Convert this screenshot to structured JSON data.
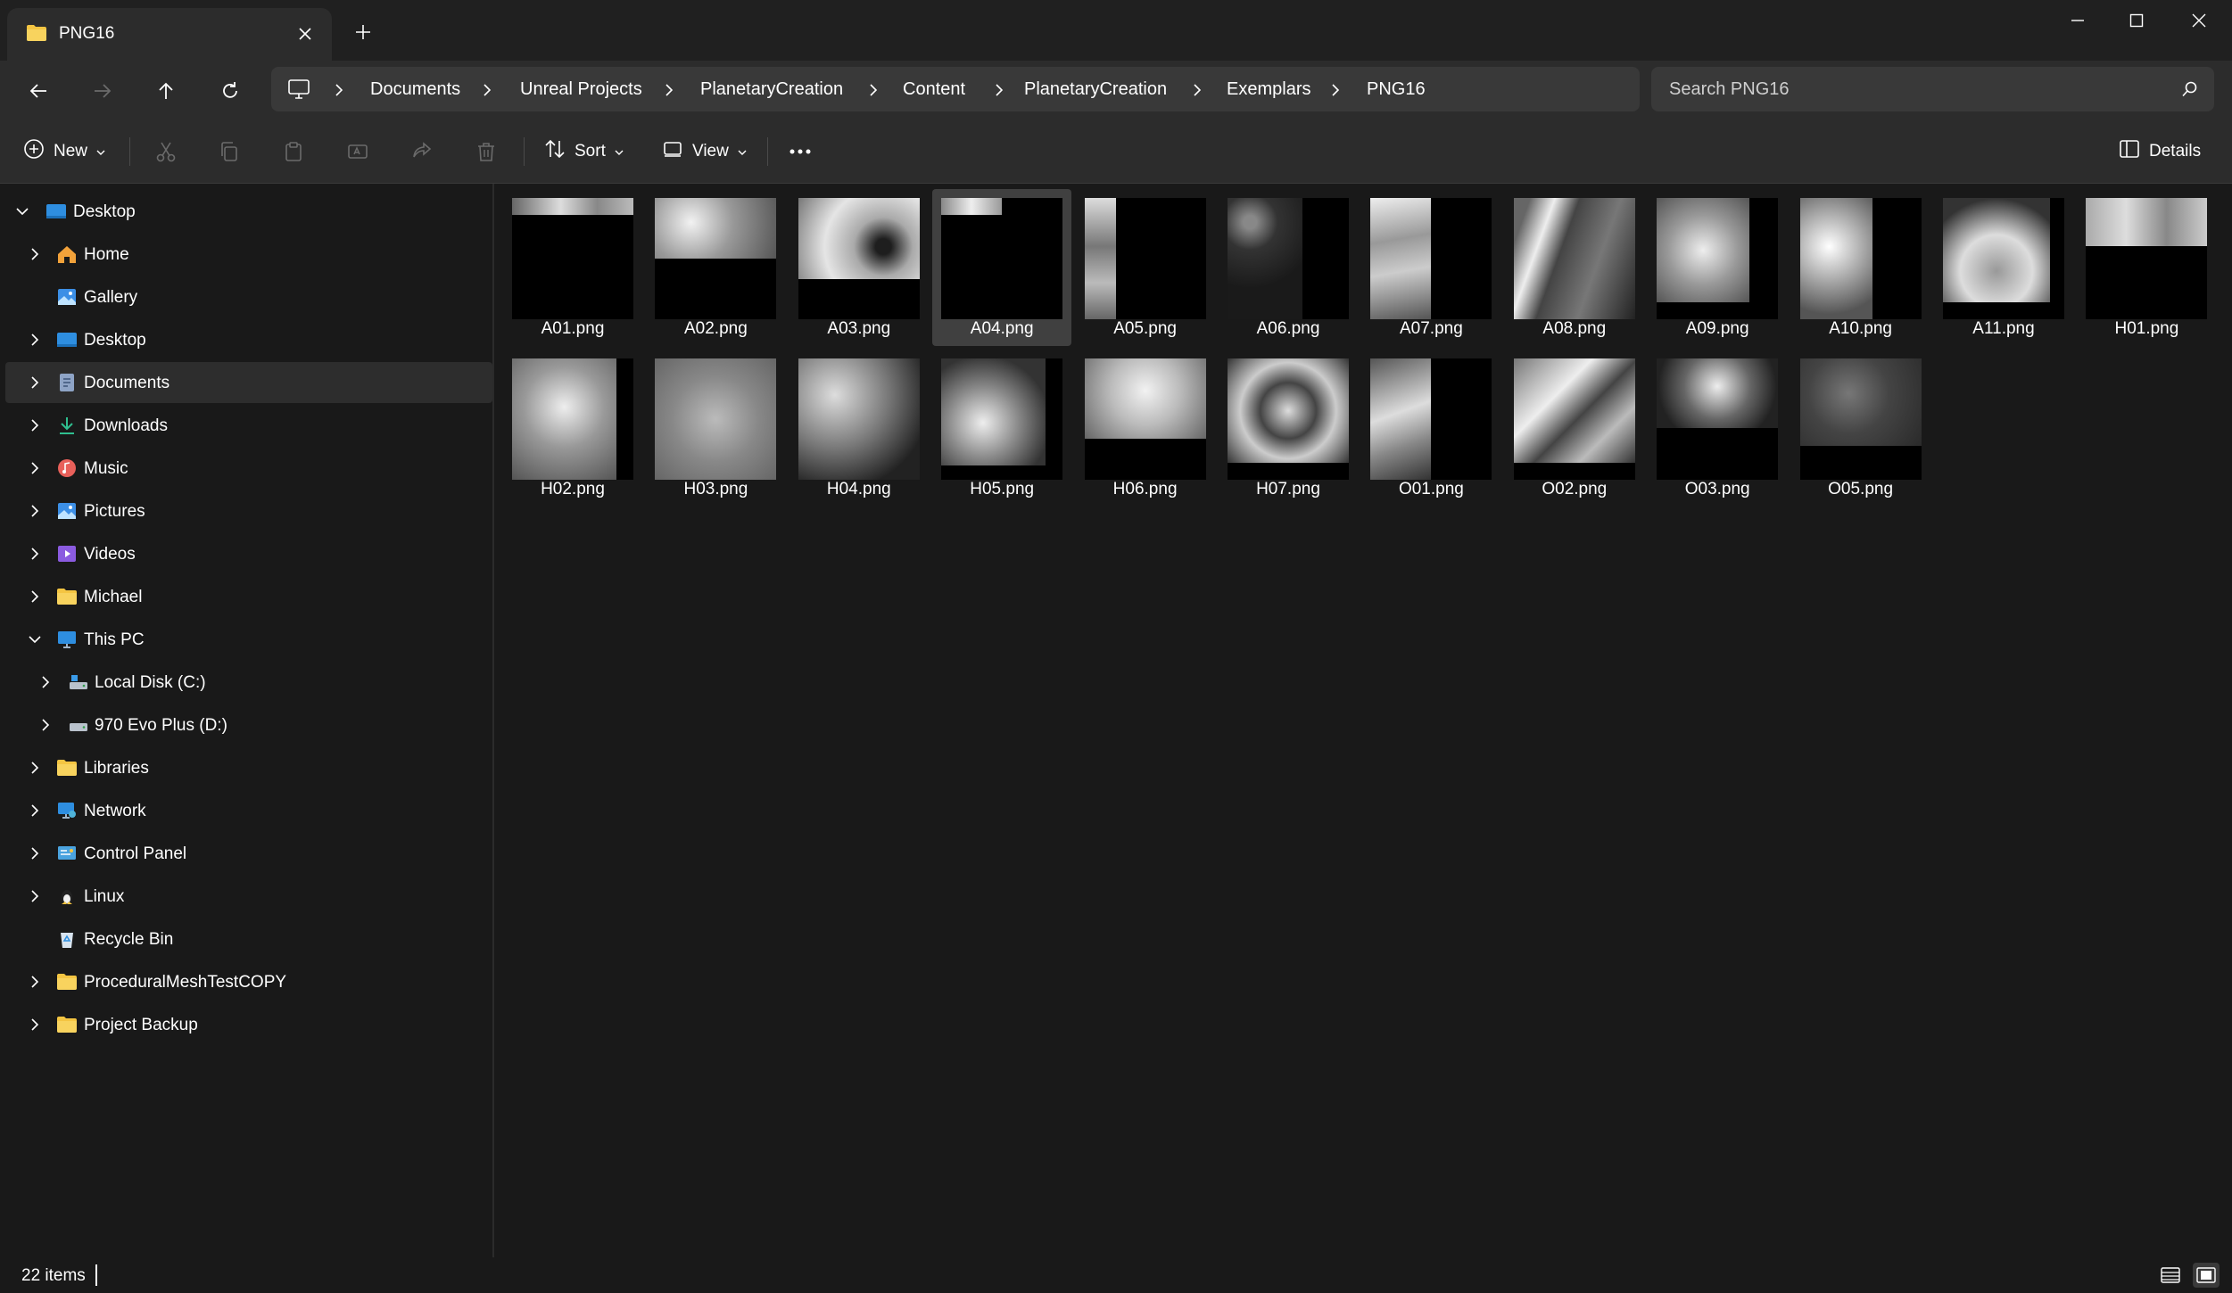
{
  "tab": {
    "title": "PNG16"
  },
  "address": {
    "breadcrumbs": [
      "Documents",
      "Unreal Projects",
      "PlanetaryCreation",
      "Content",
      "PlanetaryCreation",
      "Exemplars",
      "PNG16"
    ]
  },
  "search": {
    "placeholder": "Search PNG16"
  },
  "toolbar": {
    "new_label": "New",
    "sort_label": "Sort",
    "view_label": "View",
    "details_label": "Details"
  },
  "sidebar": {
    "items": [
      {
        "label": "Desktop",
        "icon": "desktop-icon",
        "expanded": true
      },
      {
        "label": "Home",
        "icon": "home-icon"
      },
      {
        "label": "Gallery",
        "icon": "gallery-icon"
      },
      {
        "label": "Desktop",
        "icon": "desktop-icon"
      },
      {
        "label": "Documents",
        "icon": "documents-icon",
        "selected": true
      },
      {
        "label": "Downloads",
        "icon": "download-icon"
      },
      {
        "label": "Music",
        "icon": "music-icon"
      },
      {
        "label": "Pictures",
        "icon": "pictures-icon"
      },
      {
        "label": "Videos",
        "icon": "videos-icon"
      },
      {
        "label": "Michael",
        "icon": "folder-icon"
      },
      {
        "label": "This PC",
        "icon": "computer-icon",
        "expanded": true
      },
      {
        "label": "Local Disk (C:)",
        "icon": "drive-icon"
      },
      {
        "label": "970 Evo Plus (D:)",
        "icon": "drive-icon"
      },
      {
        "label": "Libraries",
        "icon": "folder-icon"
      },
      {
        "label": "Network",
        "icon": "network-icon"
      },
      {
        "label": "Control Panel",
        "icon": "control-panel-icon"
      },
      {
        "label": "Linux",
        "icon": "linux-icon"
      },
      {
        "label": "Recycle Bin",
        "icon": "recycle-bin-icon"
      },
      {
        "label": "ProceduralMeshTestCOPY",
        "icon": "folder-icon"
      },
      {
        "label": "Project Backup",
        "icon": "folder-icon"
      }
    ]
  },
  "files": [
    {
      "name": "A01.png"
    },
    {
      "name": "A02.png"
    },
    {
      "name": "A03.png"
    },
    {
      "name": "A04.png",
      "selected": true
    },
    {
      "name": "A05.png"
    },
    {
      "name": "A06.png"
    },
    {
      "name": "A07.png"
    },
    {
      "name": "A08.png"
    },
    {
      "name": "A09.png"
    },
    {
      "name": "A10.png"
    },
    {
      "name": "A11.png"
    },
    {
      "name": "H01.png"
    },
    {
      "name": "H02.png"
    },
    {
      "name": "H03.png"
    },
    {
      "name": "H04.png"
    },
    {
      "name": "H05.png"
    },
    {
      "name": "H06.png"
    },
    {
      "name": "H07.png"
    },
    {
      "name": "O01.png"
    },
    {
      "name": "O02.png"
    },
    {
      "name": "O03.png"
    },
    {
      "name": "O05.png"
    }
  ],
  "status": {
    "item_count": "22 items"
  },
  "colors": {
    "background": "#191919",
    "chrome": "#2c2c2c",
    "selection": "#2d2d2d",
    "folder": "#f4c542",
    "accent": "#4aa3df"
  }
}
